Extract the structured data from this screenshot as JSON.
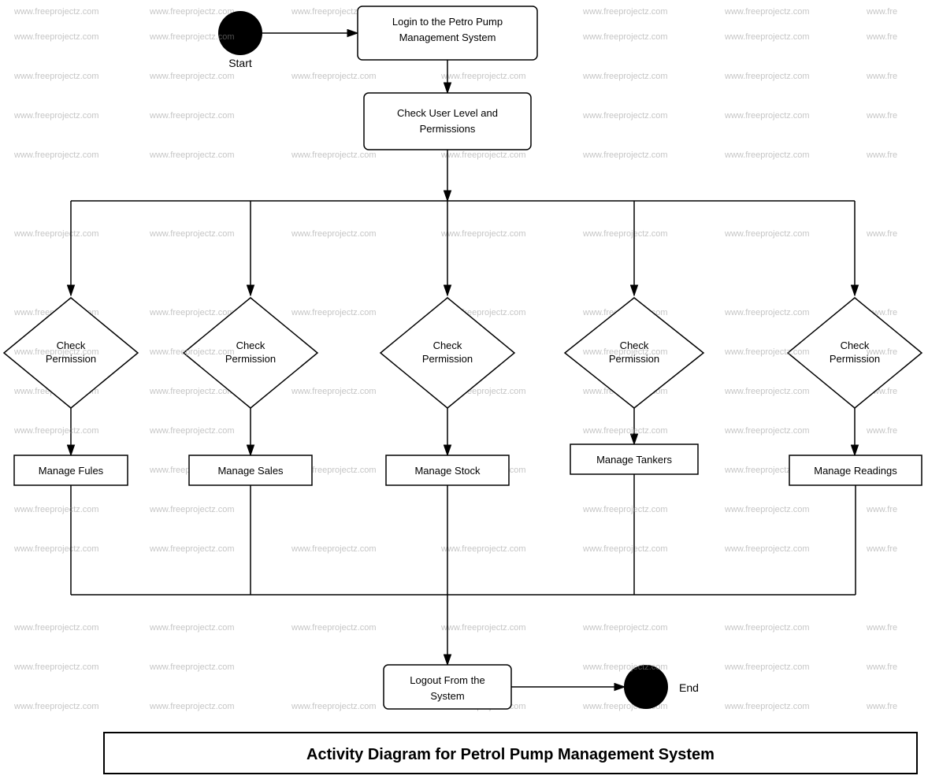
{
  "diagram": {
    "title": "Activity Diagram for Petrol Pump Management System",
    "watermark": "www.freeprojectz.com",
    "nodes": {
      "start_label": "Start",
      "login": "Login to the Petro Pump Management System",
      "check_user_level": "Check User Level and Permissions",
      "check_permission_1": "Check Permission",
      "check_permission_2": "Check Permission",
      "check_permission_3": "Check Permission",
      "check_permission_4": "Check Permission",
      "check_permission_5": "Check Permission",
      "manage_fules": "Manage Fules",
      "manage_sales": "Manage Sales",
      "manage_stock": "Manage Stock",
      "manage_tankers": "Manage Tankers",
      "manage_readings": "Manage Readings",
      "logout": "Logout From the System",
      "end_label": "End"
    }
  }
}
